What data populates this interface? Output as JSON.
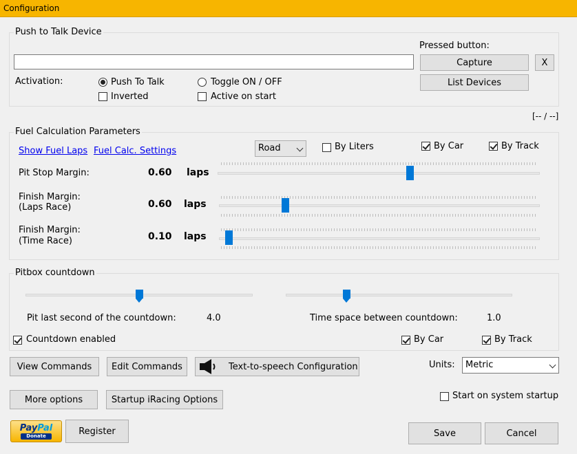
{
  "window": {
    "title": "Configuration"
  },
  "ptt": {
    "group_title": "Push to Talk Device",
    "device_value": "",
    "pressed_button_label": "Pressed button:",
    "capture_label": "Capture",
    "clear_label": "X",
    "list_devices_label": "List Devices",
    "activation_label": "Activation:",
    "push_to_talk_label": "Push To Talk",
    "push_to_talk_selected": true,
    "toggle_label": "Toggle ON / OFF",
    "toggle_selected": false,
    "inverted_label": "Inverted",
    "inverted_checked": false,
    "active_on_start_label": "Active on start",
    "active_on_start_checked": false
  },
  "status_text": "[-- / --]",
  "fuel": {
    "group_title": "Fuel Calculation Parameters",
    "show_fuel_laps_link": "Show Fuel Laps",
    "fuel_calc_settings_link": "Fuel Calc. Settings",
    "track_type_selected": "Road",
    "by_liters_label": "By Liters",
    "by_liters_checked": false,
    "by_car_label": "By Car",
    "by_car_checked": true,
    "by_track_label": "By Track",
    "by_track_checked": true,
    "pit_stop_margin_label": "Pit Stop Margin:",
    "pit_stop_margin_value": "0.60",
    "pit_stop_margin_unit": "laps",
    "pit_stop_margin_slider_fraction": 0.6,
    "finish_laps_label_1": "Finish Margin:",
    "finish_laps_label_2": "(Laps Race)",
    "finish_laps_value": "0.60",
    "finish_laps_unit": "laps",
    "finish_laps_slider_fraction": 0.2,
    "finish_time_label_1": "Finish Margin:",
    "finish_time_label_2": "(Time Race)",
    "finish_time_value": "0.10",
    "finish_time_unit": "laps",
    "finish_time_slider_fraction": 0.02
  },
  "pitbox": {
    "group_title": "Pitbox countdown",
    "last_second_label": "Pit last second of the countdown:",
    "last_second_value": "4.0",
    "last_second_slider_fraction": 0.5,
    "time_space_label": "Time space between countdown:",
    "time_space_value": "1.0",
    "time_space_slider_fraction": 0.26,
    "countdown_enabled_label": "Countdown enabled",
    "countdown_enabled_checked": true,
    "by_car_label": "By Car",
    "by_car_checked": true,
    "by_track_label": "By Track",
    "by_track_checked": true
  },
  "buttons": {
    "view_commands": "View Commands",
    "edit_commands": "Edit Commands",
    "tts_config": "Text-to-speech Configuration",
    "more_options": "More options",
    "startup_iracing": "Startup iRacing Options",
    "register": "Register",
    "save": "Save",
    "cancel": "Cancel"
  },
  "units": {
    "label": "Units:",
    "selected": "Metric"
  },
  "start_on_startup": {
    "label": "Start on system startup",
    "checked": false
  },
  "paypal": {
    "logo_text_1": "Pay",
    "logo_text_2": "Pal",
    "donate_text": "Donate"
  },
  "icons": {
    "speaker": "speaker-icon",
    "dropdown": "chevron-down-icon"
  },
  "colors": {
    "title_bar": "#f7b500",
    "slider_thumb": "#0078d7",
    "link": "#0000ee"
  }
}
